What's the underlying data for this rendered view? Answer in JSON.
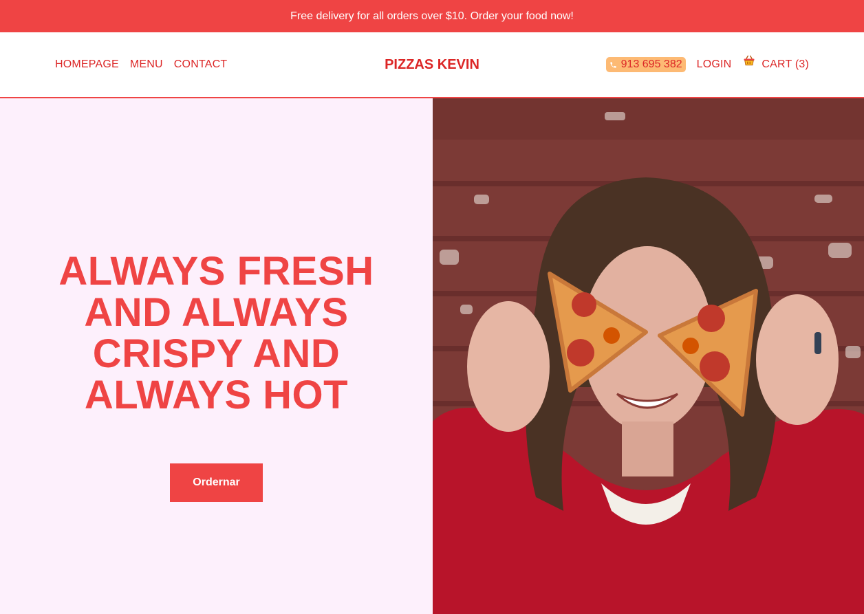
{
  "promo": {
    "text": "Free delivery for all orders over $10. Order your food now!"
  },
  "nav": {
    "links": [
      "HOMEPAGE",
      "MENU",
      "CONTACT"
    ],
    "brand": "PIZZAS KEVIN",
    "phone": "913 695 382",
    "login": "LOGIN",
    "cart": "CART (3)"
  },
  "hero": {
    "title_lines": [
      "ALWAYS FRESH",
      "AND ALWAYS",
      "CRISPY AND",
      "ALWAYS HOT"
    ],
    "cta": "Ordernar",
    "image_alt": "young man smiling holding two pepperoni pizza slices over his eyes in front of a brick wall"
  },
  "colors": {
    "accent": "#ef4444",
    "accent_dark": "#dc2626",
    "phone_badge": "#fdba74",
    "hero_bg": "#fdf0fc"
  },
  "icons": {
    "phone": "phone-icon",
    "cart": "basket-icon"
  }
}
